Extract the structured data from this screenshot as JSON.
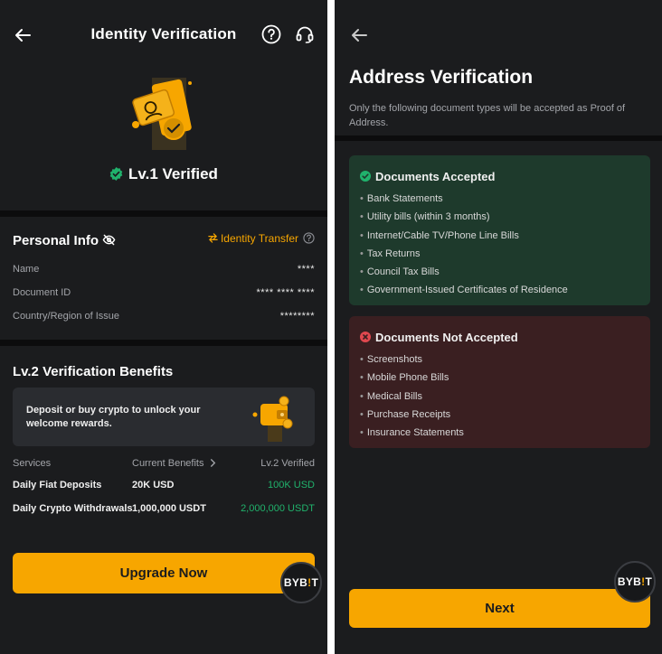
{
  "left": {
    "header": {
      "title": "Identity Verification"
    },
    "status": {
      "label": "Lv.1 Verified"
    },
    "personal_info": {
      "title": "Personal Info",
      "transfer_link": "Identity Transfer",
      "rows": [
        {
          "label": "Name",
          "value": "****"
        },
        {
          "label": "Document ID",
          "value": "**** **** ****"
        },
        {
          "label": "Country/Region of Issue",
          "value": "********"
        }
      ]
    },
    "benefits": {
      "title": "Lv.2 Verification Benefits",
      "promo_text": "Deposit or buy crypto to unlock your welcome rewards.",
      "columns": {
        "services": "Services",
        "current": "Current Benefits",
        "lv2": "Lv.2 Verified"
      },
      "rows": [
        {
          "service": "Daily Fiat Deposits",
          "current": "20K USD",
          "lv2": "100K USD"
        },
        {
          "service": "Daily Crypto Withdrawals",
          "current": "1,000,000 USDT",
          "lv2": "2,000,000 USDT"
        }
      ]
    },
    "upgrade_button": "Upgrade Now",
    "badge": {
      "prefix": "BYB",
      "bar": "!",
      "suffix": "T"
    }
  },
  "right": {
    "title": "Address Verification",
    "subtitle": "Only the following document types will be accepted as Proof of Address.",
    "accepted": {
      "title": "Documents Accepted",
      "items": [
        "Bank Statements",
        "Utility bills (within 3 months)",
        "Internet/Cable TV/Phone Line Bills",
        "Tax Returns",
        "Council Tax Bills",
        "Government-Issued Certificates of Residence"
      ]
    },
    "not_accepted": {
      "title": "Documents Not Accepted",
      "items": [
        "Screenshots",
        "Mobile Phone Bills",
        "Medical Bills",
        "Purchase Receipts",
        "Insurance Statements"
      ]
    },
    "next_button": "Next",
    "badge": {
      "prefix": "BYB",
      "bar": "!",
      "suffix": "T"
    }
  },
  "colors": {
    "accent": "#f7a600",
    "success": "#20b26c",
    "background": "#1b1c1e",
    "accepted_card": "#1e3a2c",
    "rejected_card": "#3a1f21",
    "error": "#e0484f"
  },
  "icons": [
    "back-arrow-icon",
    "help-icon",
    "headset-icon",
    "verified-check-icon",
    "eye-off-icon",
    "transfer-icon",
    "info-icon",
    "chevron-right-icon",
    "check-circle-icon",
    "x-circle-icon"
  ]
}
